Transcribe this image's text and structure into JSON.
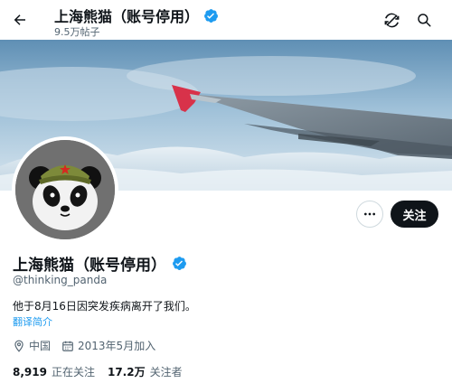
{
  "header": {
    "title": "上海熊猫（账号停用）",
    "posts_count": "9.5万帖子"
  },
  "profile": {
    "display_name": "上海熊猫（账号停用）",
    "handle": "@thinking_panda",
    "bio": "他于8月16日因突发疾病离开了我们。",
    "translate_label": "翻译简介",
    "location": "中国",
    "joined": "2013年5月加入",
    "following_count": "8,919",
    "following_label": "正在关注",
    "followers_count": "17.2万",
    "followers_label": "关注者"
  },
  "actions": {
    "follow_label": "关注"
  },
  "colors": {
    "accent": "#1d9bf0",
    "text": "#0f1419",
    "secondary_text": "#536471",
    "follow_button": "#0f1419"
  },
  "icons": [
    "back-arrow-icon",
    "verified-badge-icon",
    "refresh-icon",
    "search-icon",
    "more-icon",
    "location-icon",
    "calendar-icon"
  ]
}
